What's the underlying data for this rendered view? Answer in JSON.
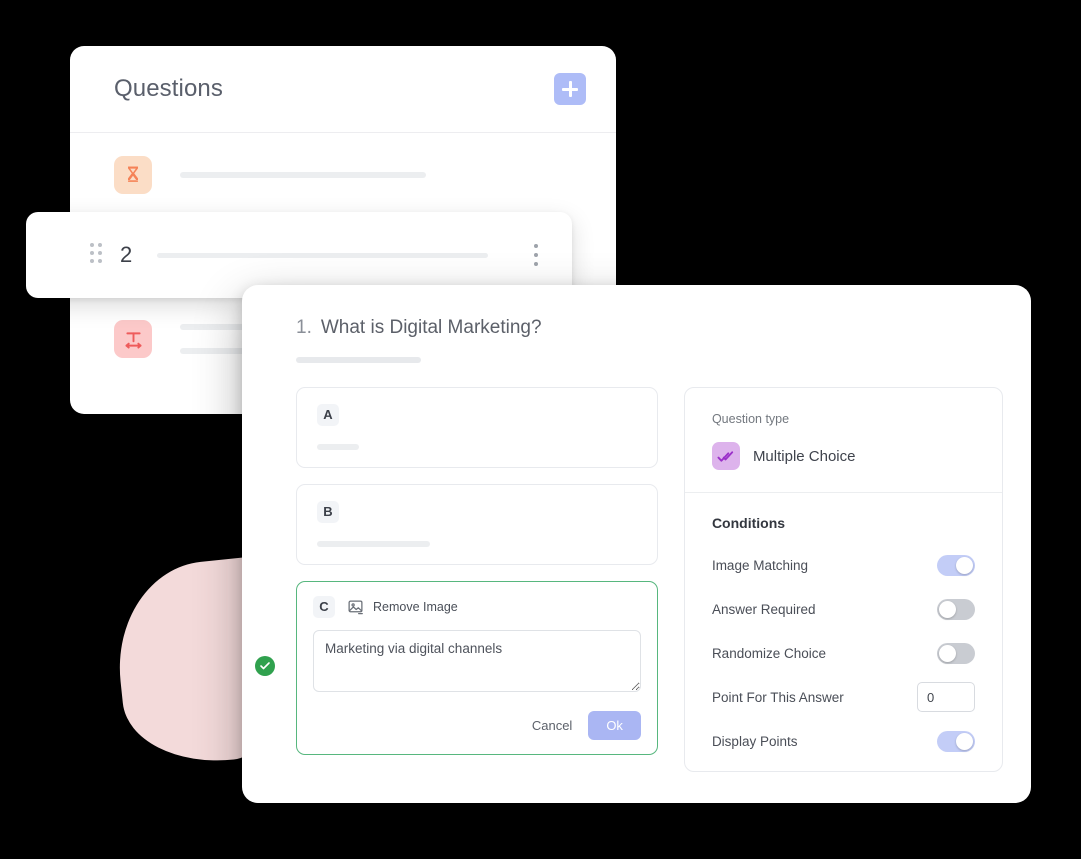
{
  "questions_card": {
    "title": "Questions",
    "add_button_label": "+",
    "rows": [
      {
        "icon": "hourglass-icon",
        "icon_bg": "#fbddc6",
        "icon_color": "#f58257",
        "skeleton_width": 246
      },
      {
        "icon": "text-width-icon",
        "icon_bg": "#fcc9c9",
        "icon_color": "#ee5b5b",
        "skeleton_width": 72
      }
    ]
  },
  "row_card": {
    "number": "2",
    "drag_handle": "drag-handle-icon",
    "menu": "kebab-menu-icon"
  },
  "dialog": {
    "number": "1.",
    "question": "What is Digital Marketing?",
    "options": [
      {
        "letter": "A",
        "skeleton_width": 42
      },
      {
        "letter": "B",
        "skeleton_width": 113
      }
    ],
    "selected_option": {
      "letter": "C",
      "remove_image_label": "Remove Image",
      "remove_image_icon": "image-remove-icon",
      "answer_text": "Marketing via digital channels",
      "cancel_label": "Cancel",
      "ok_label": "Ok",
      "correct_badge": "check-circle-icon",
      "border_color": "#57b77e"
    }
  },
  "settings": {
    "question_type_label": "Question type",
    "question_type_value": "Multiple Choice",
    "question_type_icon": "double-check-icon",
    "question_type_icon_bg": "#ddb3ec",
    "conditions_title": "Conditions",
    "conditions": [
      {
        "label": "Image Matching",
        "control": "toggle",
        "state": "on"
      },
      {
        "label": "Answer Required",
        "control": "toggle",
        "state": "off"
      },
      {
        "label": "Randomize Choice",
        "control": "toggle",
        "state": "off"
      },
      {
        "label": "Point For This Answer",
        "control": "input",
        "value": "0"
      },
      {
        "label": "Display Points",
        "control": "toggle",
        "state": "on"
      }
    ]
  },
  "theme": {
    "accent_blue": "#aab6f3",
    "accent_green": "#30a14e",
    "accent_purple": "#ddb3ec",
    "background": "#000000"
  }
}
